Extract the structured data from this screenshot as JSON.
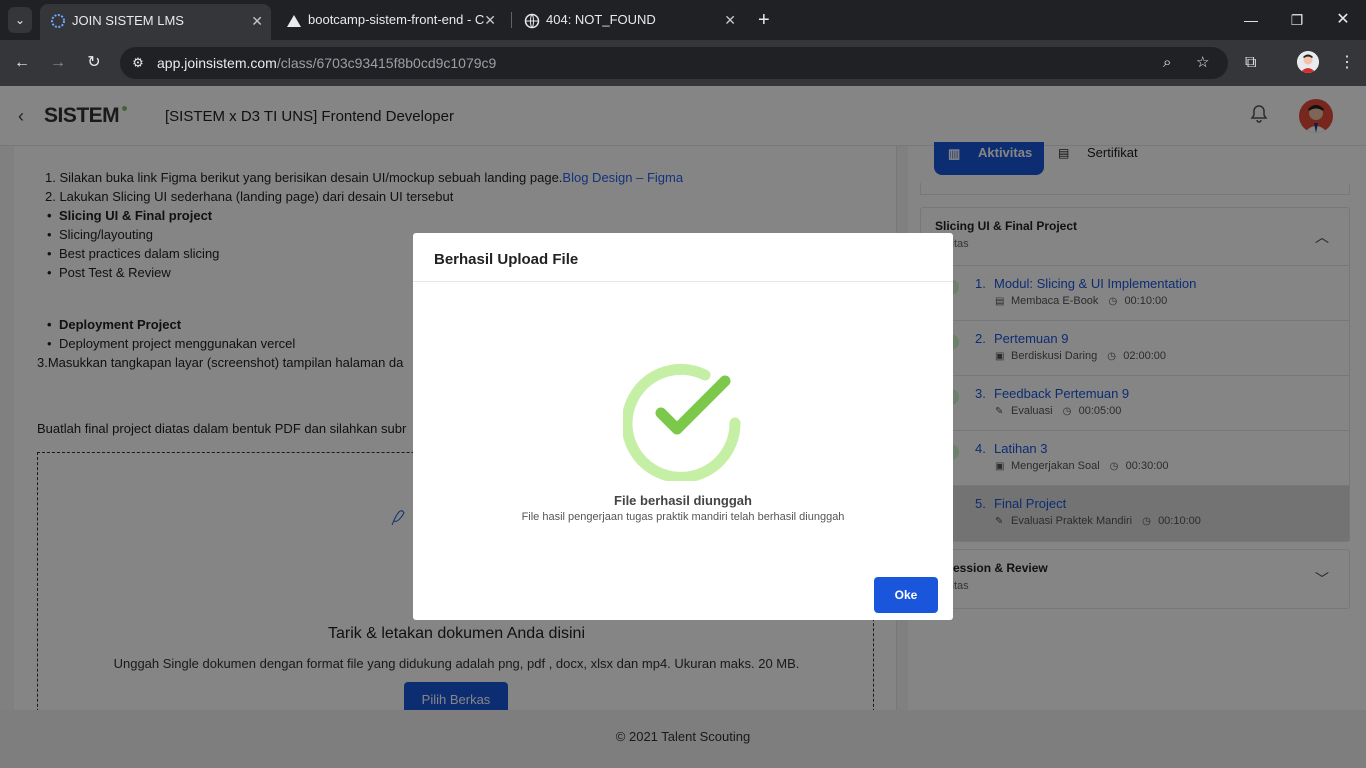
{
  "browser": {
    "tabs": [
      {
        "title": "JOIN SISTEM LMS",
        "active": true
      },
      {
        "title": "bootcamp-sistem-front-end - C",
        "active": false
      },
      {
        "title": "404: NOT_FOUND",
        "active": false
      }
    ],
    "url_host": "app.joinsistem.com",
    "url_path": "/class/6703c93415f8b0cd9c1079c9"
  },
  "header": {
    "logo": "SISTEM",
    "course_title": "[SISTEM x D3 TI UNS] Frontend Developer"
  },
  "content": {
    "lines": [
      {
        "text": "1. Silakan buka link Figma berikut yang berisikan desain UI/mockup sebuah landing page.",
        "link": "Blog Design – Figma"
      },
      {
        "text": "2. Lakukan Slicing UI sederhana (landing page) dari desain UI tersebut"
      }
    ],
    "bullets1": [
      "Slicing UI & Final project",
      "Slicing/layouting",
      "Best practices dalam slicing",
      "Post Test & Review"
    ],
    "bullets2": [
      "Deployment Project",
      "Deployment project menggunakan vercel"
    ],
    "step3": "3.Masukkan tangkapan layar (screenshot) tampilan halaman da",
    "final_note": "Buatlah final project diatas dalam bentuk PDF dan silahkan subr",
    "dropzone": {
      "title": "Tarik & letakan dokumen Anda disini",
      "desc": "Unggah Single dokumen dengan format file yang didukung adalah png, pdf , docx, xlsx dan mp4. Ukuran maks. 20 MB.",
      "button": "Pilih Berkas"
    }
  },
  "sidebar": {
    "tabs": {
      "activity": "Aktivitas",
      "certificate": "Sertifikat"
    },
    "section1": {
      "title": "Slicing UI & Final Project",
      "subtitle": "ktivitas",
      "items": [
        {
          "num": "1.",
          "title": "Modul: Slicing & UI Implementation",
          "type": "Membaca E-Book",
          "duration": "00:10:00"
        },
        {
          "num": "2.",
          "title": "Pertemuan 9",
          "type": "Berdiskusi Daring",
          "duration": "02:00:00"
        },
        {
          "num": "3.",
          "title": "Feedback Pertemuan 9",
          "type": "Evaluasi",
          "duration": "00:05:00"
        },
        {
          "num": "4.",
          "title": "Latihan 3",
          "type": "Mengerjakan Soal",
          "duration": "00:30:00"
        },
        {
          "num": "5.",
          "title": "Final Project",
          "type": "Evaluasi Praktek Mandiri",
          "duration": "00:10:00"
        }
      ]
    },
    "section2": {
      "title": "e Session & Review",
      "subtitle": "ktivitas"
    }
  },
  "footer": {
    "text": "© 2021 Talent Scouting"
  },
  "modal": {
    "title": "Berhasil Upload File",
    "message": "File berhasil diunggah",
    "sub": "File hasil pengerjaan tugas praktik mandiri telah berhasil diunggah",
    "ok": "Oke"
  },
  "colors": {
    "primary": "#1a56db",
    "success": "#7cc84a",
    "success_light": "#c6efa6"
  }
}
